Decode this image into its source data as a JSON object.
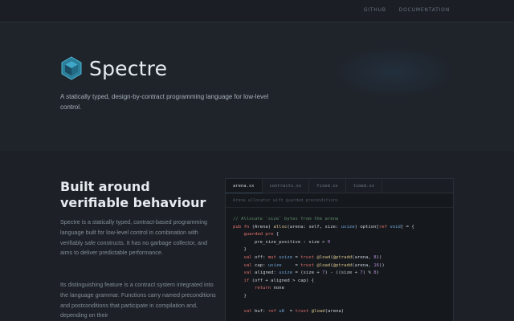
{
  "nav": {
    "github": "GITHUB",
    "docs": "DOCUMENTATION"
  },
  "hero": {
    "brand": "Spectre",
    "tagline": "A statically typed, design-by-contract programming language for low-level control."
  },
  "section": {
    "title": "Built around verifiable behaviour",
    "paragraph1": "Spectre is a statically typed, contract-based programming language built for low-level control in combination with verifiably safe constructs. It has no garbage collector, and aims to deliver predictable performance.",
    "paragraph2": "Its distinguishing feature is a contract system integrated into the language grammar. Functions carry named preconditions and postconditions that participate in compilation and, depending on their"
  },
  "editor": {
    "tabs": [
      "arena.sx",
      "contracts.sx",
      "fixed.sx",
      "timed.sx"
    ],
    "caption": "Arena allocator with guarded preconditions",
    "lines": [
      [
        {
          "c": "com",
          "t": "// Allocate `size` bytes from the arena"
        }
      ],
      [
        {
          "c": "kw",
          "t": "pub fn "
        },
        {
          "c": "",
          "t": "(Arena) "
        },
        {
          "c": "fn",
          "t": "alloc"
        },
        {
          "c": "",
          "t": "(arena: self, size: "
        },
        {
          "c": "ty",
          "t": "usize"
        },
        {
          "c": "",
          "t": ") option["
        },
        {
          "c": "kw",
          "t": "ref "
        },
        {
          "c": "ty",
          "t": "void"
        },
        {
          "c": "",
          "t": "] = {"
        }
      ],
      [
        {
          "c": "",
          "t": "    "
        },
        {
          "c": "kw",
          "t": "guarded pre "
        },
        {
          "c": "",
          "t": "{"
        }
      ],
      [
        {
          "c": "",
          "t": "        pre_size_positive : size > "
        },
        {
          "c": "num",
          "t": "0"
        }
      ],
      [
        {
          "c": "",
          "t": "    }"
        }
      ],
      [
        {
          "c": "",
          "t": "    "
        },
        {
          "c": "kw",
          "t": "val "
        },
        {
          "c": "",
          "t": "off: "
        },
        {
          "c": "kw",
          "t": "mut "
        },
        {
          "c": "ty",
          "t": "usize"
        },
        {
          "c": "",
          "t": " = "
        },
        {
          "c": "kw",
          "t": "trust "
        },
        {
          "c": "fn",
          "t": "@load"
        },
        {
          "c": "",
          "t": "("
        },
        {
          "c": "fn",
          "t": "@ptradd"
        },
        {
          "c": "",
          "t": "(arena, "
        },
        {
          "c": "num",
          "t": "8"
        },
        {
          "c": "",
          "t": "))"
        }
      ],
      [
        {
          "c": "",
          "t": "    "
        },
        {
          "c": "kw",
          "t": "val "
        },
        {
          "c": "",
          "t": "cap: "
        },
        {
          "c": "ty",
          "t": "usize"
        },
        {
          "c": "",
          "t": "     = "
        },
        {
          "c": "kw",
          "t": "trust "
        },
        {
          "c": "fn",
          "t": "@load"
        },
        {
          "c": "",
          "t": "("
        },
        {
          "c": "fn",
          "t": "@ptradd"
        },
        {
          "c": "",
          "t": "(arena, "
        },
        {
          "c": "num",
          "t": "16"
        },
        {
          "c": "",
          "t": "))"
        }
      ],
      [
        {
          "c": "",
          "t": "    "
        },
        {
          "c": "kw",
          "t": "val "
        },
        {
          "c": "",
          "t": "aligned: "
        },
        {
          "c": "ty",
          "t": "usize"
        },
        {
          "c": "",
          "t": " = (size + "
        },
        {
          "c": "num",
          "t": "7"
        },
        {
          "c": "",
          "t": ") - ((size + "
        },
        {
          "c": "num",
          "t": "7"
        },
        {
          "c": "",
          "t": ") % "
        },
        {
          "c": "num",
          "t": "8"
        },
        {
          "c": "",
          "t": ")"
        }
      ],
      [
        {
          "c": "",
          "t": "    "
        },
        {
          "c": "kw",
          "t": "if "
        },
        {
          "c": "",
          "t": "(off + aligned > cap) {"
        }
      ],
      [
        {
          "c": "",
          "t": "        "
        },
        {
          "c": "kw",
          "t": "return "
        },
        {
          "c": "",
          "t": "none"
        }
      ],
      [
        {
          "c": "",
          "t": "    }"
        }
      ],
      [
        {
          "c": "",
          "t": ""
        }
      ],
      [
        {
          "c": "",
          "t": "    "
        },
        {
          "c": "kw",
          "t": "val "
        },
        {
          "c": "",
          "t": "buf: "
        },
        {
          "c": "kw",
          "t": "ref "
        },
        {
          "c": "ty",
          "t": "u8"
        },
        {
          "c": "",
          "t": "  = "
        },
        {
          "c": "kw",
          "t": "trust "
        },
        {
          "c": "fn",
          "t": "@load"
        },
        {
          "c": "",
          "t": "(arena)"
        }
      ]
    ]
  },
  "colors": {
    "background": "#1d2127",
    "logo": "#3fa7c7",
    "keyword": "#e0706b",
    "type": "#6fa3d8"
  }
}
